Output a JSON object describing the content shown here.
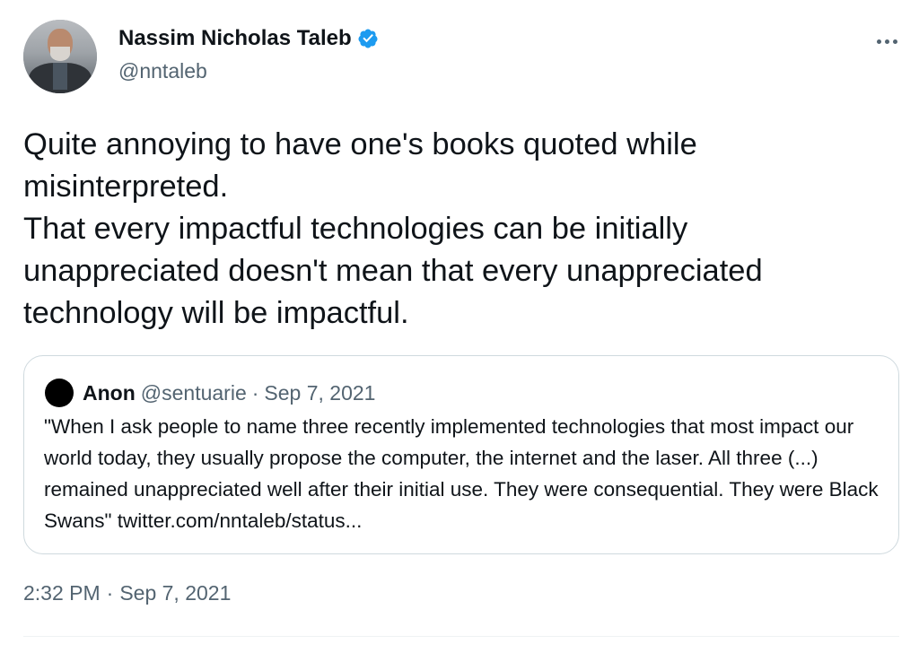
{
  "author": {
    "display_name": "Nassim Nicholas Taleb",
    "handle": "@nntaleb",
    "verified_icon": "verified-badge-icon",
    "verified_color": "#1d9bf0"
  },
  "tweet": {
    "text": "Quite annoying to have one's books quoted while\nmisinterpreted.\nThat every impactful technologies can be initially\nunappreciated doesn't mean that every unappreciated\ntechnology will be impactful.",
    "time": "2:32 PM",
    "separator": "·",
    "date": "Sep 7, 2021"
  },
  "quoted": {
    "name": "Anon",
    "handle": "@sentuarie",
    "separator": "·",
    "date": "Sep 7, 2021",
    "text": "\"When I ask people to name three recently implemented technologies that most impact our world today, they usually propose the computer, the internet and the laser. All three (...) remained unappreciated well after their initial use. They were consequential. They were Black Swans\" twitter.com/nntaleb/status..."
  },
  "colors": {
    "text_primary": "#0f1419",
    "text_secondary": "#536471",
    "border": "#cfd9de"
  }
}
